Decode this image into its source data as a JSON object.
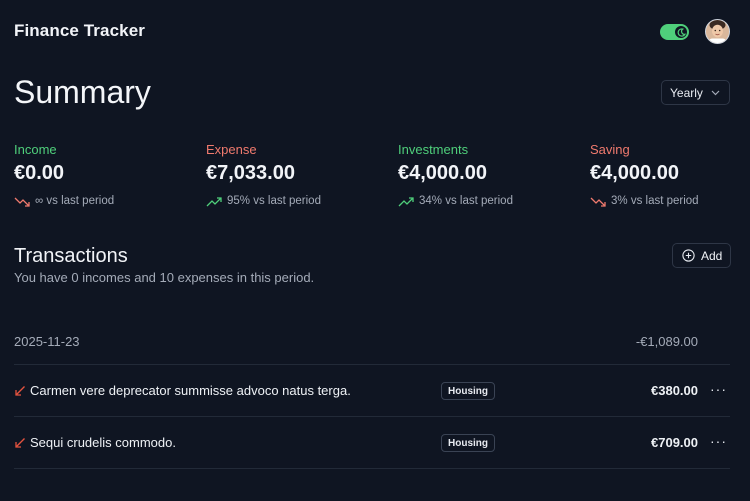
{
  "header": {
    "title": "Finance Tracker",
    "theme_toggle_icon": "moon-icon",
    "avatar_icon": "user-avatar"
  },
  "summary": {
    "title": "Summary",
    "period": "Yearly",
    "stats": [
      {
        "label": "Income",
        "value": "€0.00",
        "change": "∞ vs last period",
        "trend": "down",
        "color": "#4fcf7b"
      },
      {
        "label": "Expense",
        "value": "€7,033.00",
        "change": "95% vs last period",
        "trend": "up",
        "color": "#f07a6e"
      },
      {
        "label": "Investments",
        "value": "€4,000.00",
        "change": "34% vs last period",
        "trend": "up",
        "color": "#4fcf7b"
      },
      {
        "label": "Saving",
        "value": "€4,000.00",
        "change": "3% vs last period",
        "trend": "down",
        "color": "#f07a6e"
      }
    ]
  },
  "transactions": {
    "title": "Transactions",
    "subtitle": "You have 0 incomes and 10 expenses in this period.",
    "add_label": "Add",
    "group": {
      "date": "2025-11-23",
      "total": "-€1,089.00"
    },
    "rows": [
      {
        "description": "Carmen vere deprecator summisse advoco natus terga.",
        "category": "Housing",
        "amount": "€380.00",
        "menu": "···"
      },
      {
        "description": "Sequi crudelis commodo.",
        "category": "Housing",
        "amount": "€709.00",
        "menu": "···"
      }
    ]
  },
  "colors": {
    "background": "#0f1522",
    "green": "#4fcf7b",
    "red": "#f07a6e",
    "muted": "#a4abb8"
  }
}
